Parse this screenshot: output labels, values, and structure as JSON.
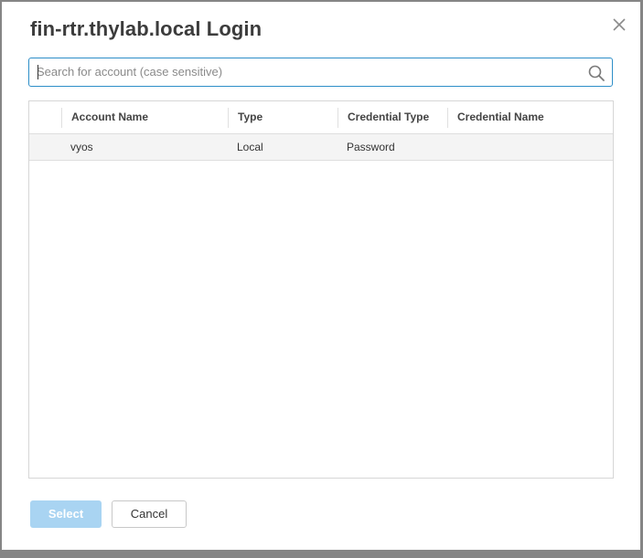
{
  "dialog": {
    "title": "fin-rtr.thylab.local Login",
    "close_icon": "close-icon"
  },
  "search": {
    "value": "",
    "placeholder": "Search for account (case sensitive)",
    "icon": "search-icon"
  },
  "table": {
    "columns": [
      "Account Name",
      "Type",
      "Credential Type",
      "Credential Name"
    ],
    "rows": [
      {
        "account_name": "vyos",
        "type": "Local",
        "credential_type": "Password",
        "credential_name": ""
      }
    ]
  },
  "buttons": {
    "select_label": "Select",
    "cancel_label": "Cancel"
  },
  "colors": {
    "accent": "#2d8ec8",
    "select_disabled": "#a9d4f2"
  }
}
